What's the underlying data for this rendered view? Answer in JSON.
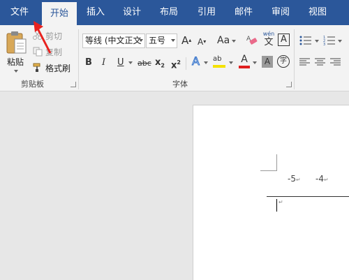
{
  "tabs": [
    {
      "label": "文件"
    },
    {
      "label": "开始"
    },
    {
      "label": "插入"
    },
    {
      "label": "设计"
    },
    {
      "label": "布局"
    },
    {
      "label": "引用"
    },
    {
      "label": "邮件"
    },
    {
      "label": "审阅"
    },
    {
      "label": "视图"
    }
  ],
  "clipboard": {
    "paste_label": "粘贴",
    "cut_label": "剪切",
    "copy_label": "复制",
    "format_painter_label": "格式刷",
    "group_label": "剪贴板"
  },
  "font": {
    "font_name": "等线 (中文正文",
    "font_size": "五号",
    "group_label": "字体",
    "grow_icon": "A",
    "shrink_icon": "A",
    "case_icon": "Aa",
    "phonetic_top": "wén",
    "phonetic_main": "文",
    "border_char": "A",
    "bold": "B",
    "italic": "I",
    "underline": "U",
    "strike": "abc",
    "subscript": "x",
    "superscript": "x",
    "text_effect": "A",
    "highlight": "ab",
    "font_color": "A",
    "shade_char": "A",
    "enclose_char": "字",
    "font_color_value": "#e02020",
    "highlight_color_value": "#f5e200"
  },
  "document": {
    "ruler_values": [
      "-5",
      "-4"
    ],
    "paragraph_mark": "↵"
  },
  "annotation": {
    "arrow_color": "#e8221f"
  },
  "colors": {
    "tabbar": "#2b579a",
    "ribbon": "#f3f3f3",
    "workspace": "#e7e7e7"
  }
}
